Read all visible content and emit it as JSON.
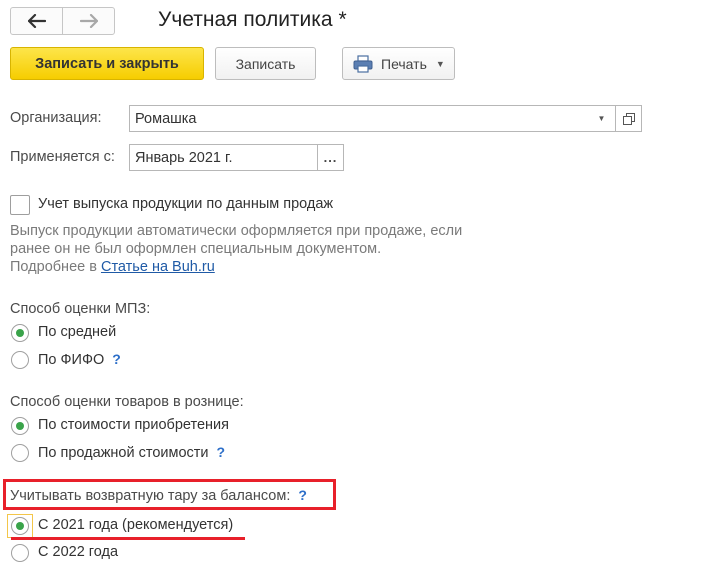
{
  "window": {
    "title": "Учетная политика *"
  },
  "toolbar": {
    "save_close_label": "Записать и закрыть",
    "save_label": "Записать",
    "print_label": "Печать"
  },
  "organization": {
    "label": "Организация:",
    "value": "Ромашка"
  },
  "applies_from": {
    "label": "Применяется с:",
    "value": "Январь 2021 г.",
    "select_button": "..."
  },
  "production_output": {
    "label": "Учет выпуска продукции по данным продаж",
    "checked": false,
    "note_line1": "Выпуск продукции автоматически оформляется при продаже, если",
    "note_line2": "ранее он не был оформлен специальным документом.",
    "note_prefix": "Подробнее в ",
    "note_link": "Статье на Buh.ru"
  },
  "inventory_valuation": {
    "label": "Способ оценки МПЗ:",
    "options": [
      {
        "label": "По средней",
        "selected": true
      },
      {
        "label": "По ФИФО",
        "selected": false,
        "help": "?"
      }
    ]
  },
  "retail_valuation": {
    "label": "Способ оценки товаров в рознице:",
    "options": [
      {
        "label": "По стоимости приобретения",
        "selected": true
      },
      {
        "label": "По продажной стоимости",
        "selected": false,
        "help": "?"
      }
    ]
  },
  "returnable_packaging": {
    "label": "Учитывать возвратную тару за балансом:",
    "help": "?",
    "options": [
      {
        "label": "С 2021 года (рекомендуется)",
        "selected": true
      },
      {
        "label": "С 2022 года",
        "selected": false
      }
    ]
  },
  "colors": {
    "primary_button": "#f6cd00",
    "radio_selected": "#3aa34a",
    "annotation": "#e8202a",
    "link": "#1f5aa6",
    "help": "#2d6fc9"
  }
}
